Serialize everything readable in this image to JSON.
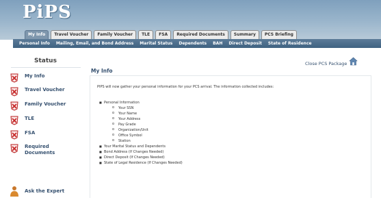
{
  "header": {
    "logo": "PiPS",
    "tabs": [
      {
        "label": "My Info",
        "active": true
      },
      {
        "label": "Travel Voucher",
        "active": false
      },
      {
        "label": "Family Voucher",
        "active": false
      },
      {
        "label": "TLE",
        "active": false
      },
      {
        "label": "FSA",
        "active": false
      },
      {
        "label": "Required Documents",
        "active": false
      },
      {
        "label": "Summary",
        "active": false
      },
      {
        "label": "PCS Briefing",
        "active": false
      }
    ]
  },
  "subnav": [
    "Personal Info",
    "Mailing, Email, and Bond Address",
    "Marital Status",
    "Dependents",
    "BAH",
    "Direct Deposit",
    "State of Residence"
  ],
  "sidebar": {
    "title": "Status",
    "items": [
      {
        "label": "My Info"
      },
      {
        "label": "Travel Voucher"
      },
      {
        "label": "Family Voucher"
      },
      {
        "label": "TLE"
      },
      {
        "label": "FSA"
      },
      {
        "label": "Required Documents"
      }
    ],
    "expert_label": "Ask the Expert"
  },
  "main": {
    "title": "My Info",
    "close_link": "Close PCS Package",
    "intro": "PIPS will now gather your personal information for your PCS arrival. The information collected includes:",
    "items": [
      {
        "text": "Personal Information",
        "level": 1
      },
      {
        "text": "Your SSN",
        "level": 2
      },
      {
        "text": "Your Name",
        "level": 2
      },
      {
        "text": "Your Address",
        "level": 2
      },
      {
        "text": "Pay Grade",
        "level": 2
      },
      {
        "text": "Organization/Unit",
        "level": 2
      },
      {
        "text": "Office Symbol",
        "level": 2
      },
      {
        "text": "Station",
        "level": 2
      },
      {
        "text": "Your Marital Status and Dependents",
        "level": 1
      },
      {
        "text": "Bond Address (If Changes Needed)",
        "level": 1
      },
      {
        "text": "Direct Deposit (If Changes Needed)",
        "level": 1
      },
      {
        "text": "State of Legal Residence (If Changes Needed)",
        "level": 1
      }
    ]
  },
  "colors": {
    "header_blue": "#8aa8c2",
    "subnav_blue": "#4a6b8a",
    "link_blue": "#35506f",
    "status_red": "#c62828"
  }
}
